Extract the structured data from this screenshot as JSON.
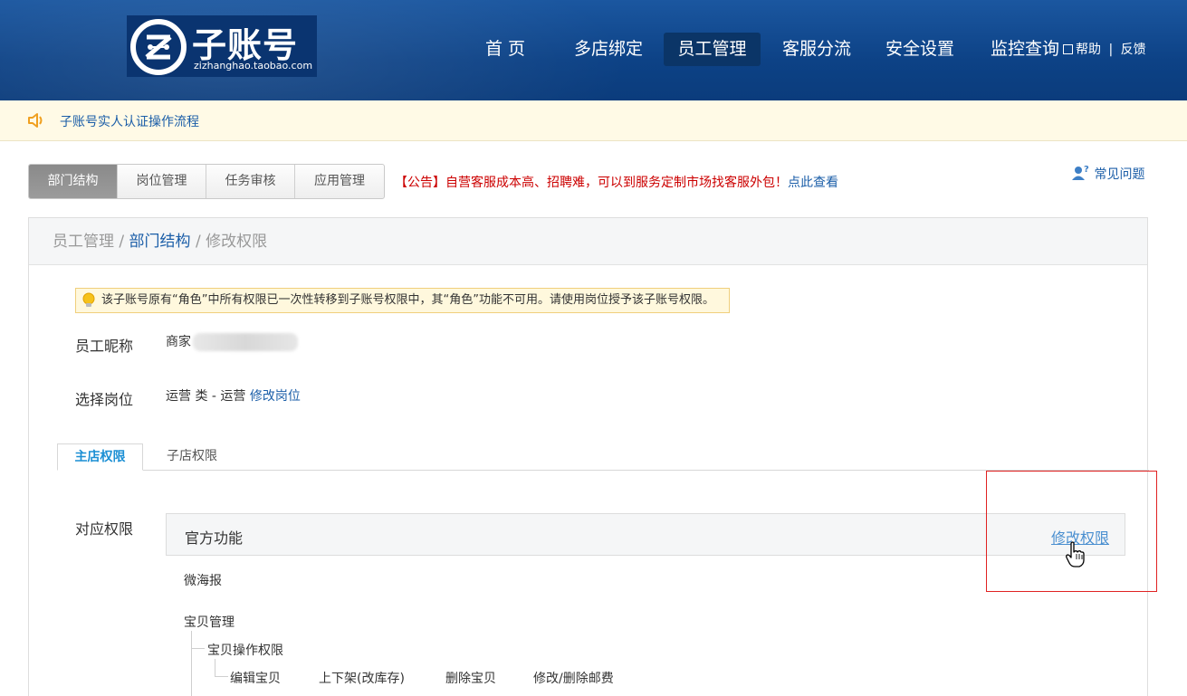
{
  "header": {
    "logo_title": "子账号",
    "logo_url": "zizhanghao.taobao.com",
    "nav": [
      {
        "label": "首 页",
        "active": false
      },
      {
        "label": "多店绑定",
        "active": false
      },
      {
        "label": "员工管理",
        "active": true
      },
      {
        "label": "客服分流",
        "active": false
      },
      {
        "label": "安全设置",
        "active": false
      },
      {
        "label": "监控查询",
        "active": false
      }
    ],
    "help": "帮助",
    "separator": "|",
    "feedback": "反馈"
  },
  "notice": {
    "text": "子账号实人认证操作流程"
  },
  "tabs": [
    {
      "label": "部门结构",
      "active": true
    },
    {
      "label": "岗位管理",
      "active": false
    },
    {
      "label": "任务审核",
      "active": false
    },
    {
      "label": "应用管理",
      "active": false
    }
  ],
  "bulletin": {
    "text": "【公告】自营客服成本高、招聘难，可以到服务定制市场找客服外包！",
    "link": "点此查看"
  },
  "faq": "常见问题",
  "breadcrumb": {
    "first": "员工管理",
    "sep": " / ",
    "second": "部门结构",
    "third": "修改权限"
  },
  "tip": "该子账号原有“角色”中所有权限已一次性转移到子账号权限中，其“角色”功能不可用。请使用岗位授予该子账号权限。",
  "employee": {
    "nickname_label": "员工昵称",
    "nickname_value": "商家",
    "position_label": "选择岗位",
    "position_value": "运营 类 - 运营",
    "position_edit": "修改岗位"
  },
  "subtabs": [
    {
      "label": "主店权限",
      "active": true
    },
    {
      "label": "子店权限",
      "active": false
    }
  ],
  "permissions": {
    "label": "对应权限",
    "group_title": "官方功能",
    "edit_link": "修改权限",
    "items": [
      {
        "label": "微海报"
      },
      {
        "label": "宝贝管理"
      },
      {
        "label": "宝贝操作权限"
      },
      {
        "label": "编辑宝贝"
      },
      {
        "label": "上下架(改库存)"
      },
      {
        "label": "删除宝贝"
      },
      {
        "label": "修改/删除邮费"
      }
    ]
  },
  "colors": {
    "header_blue": "#0d4286",
    "link_blue": "#1b5ea8",
    "alert_red": "#cc0000",
    "highlight_red": "#e02222"
  }
}
